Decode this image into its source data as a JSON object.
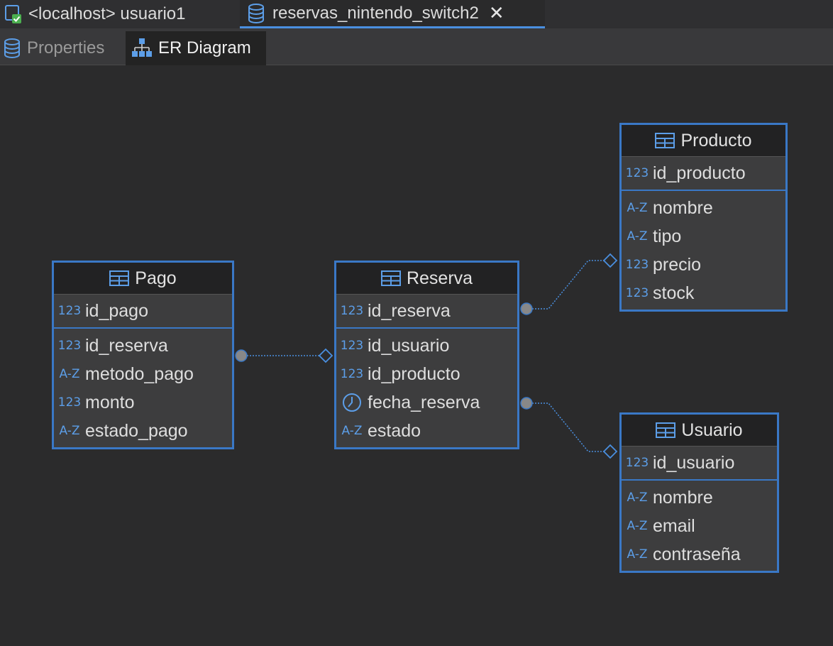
{
  "tabs": [
    {
      "label": "<localhost> usuario1",
      "icon": "connection-icon"
    },
    {
      "label": "reservas_nintendo_switch2",
      "icon": "database-icon",
      "closable": true
    }
  ],
  "subtabs": [
    {
      "label": "Properties",
      "icon": "database-icon"
    },
    {
      "label": "ER Diagram",
      "icon": "er-diagram-icon"
    }
  ],
  "colors": {
    "accent": "#3a78c6",
    "type_icon": "#5c9ee8",
    "background": "#2b2b2c"
  },
  "entities": {
    "pago": {
      "name": "Pago",
      "pk": {
        "type": "123",
        "name": "id_pago"
      },
      "fields": [
        {
          "type": "123",
          "name": "id_reserva"
        },
        {
          "type": "A-Z",
          "name": "metodo_pago"
        },
        {
          "type": "123",
          "name": "monto"
        },
        {
          "type": "A-Z",
          "name": "estado_pago"
        }
      ]
    },
    "reserva": {
      "name": "Reserva",
      "pk": {
        "type": "123",
        "name": "id_reserva"
      },
      "fields": [
        {
          "type": "123",
          "name": "id_usuario"
        },
        {
          "type": "123",
          "name": "id_producto"
        },
        {
          "type": "clock",
          "name": "fecha_reserva"
        },
        {
          "type": "A-Z",
          "name": "estado"
        }
      ]
    },
    "producto": {
      "name": "Producto",
      "pk": {
        "type": "123",
        "name": "id_producto"
      },
      "fields": [
        {
          "type": "A-Z",
          "name": "nombre"
        },
        {
          "type": "A-Z",
          "name": "tipo"
        },
        {
          "type": "123",
          "name": "precio"
        },
        {
          "type": "123",
          "name": "stock"
        }
      ]
    },
    "usuario": {
      "name": "Usuario",
      "pk": {
        "type": "123",
        "name": "id_usuario"
      },
      "fields": [
        {
          "type": "A-Z",
          "name": "nombre"
        },
        {
          "type": "A-Z",
          "name": "email"
        },
        {
          "type": "A-Z",
          "name": "contraseña"
        }
      ]
    }
  }
}
